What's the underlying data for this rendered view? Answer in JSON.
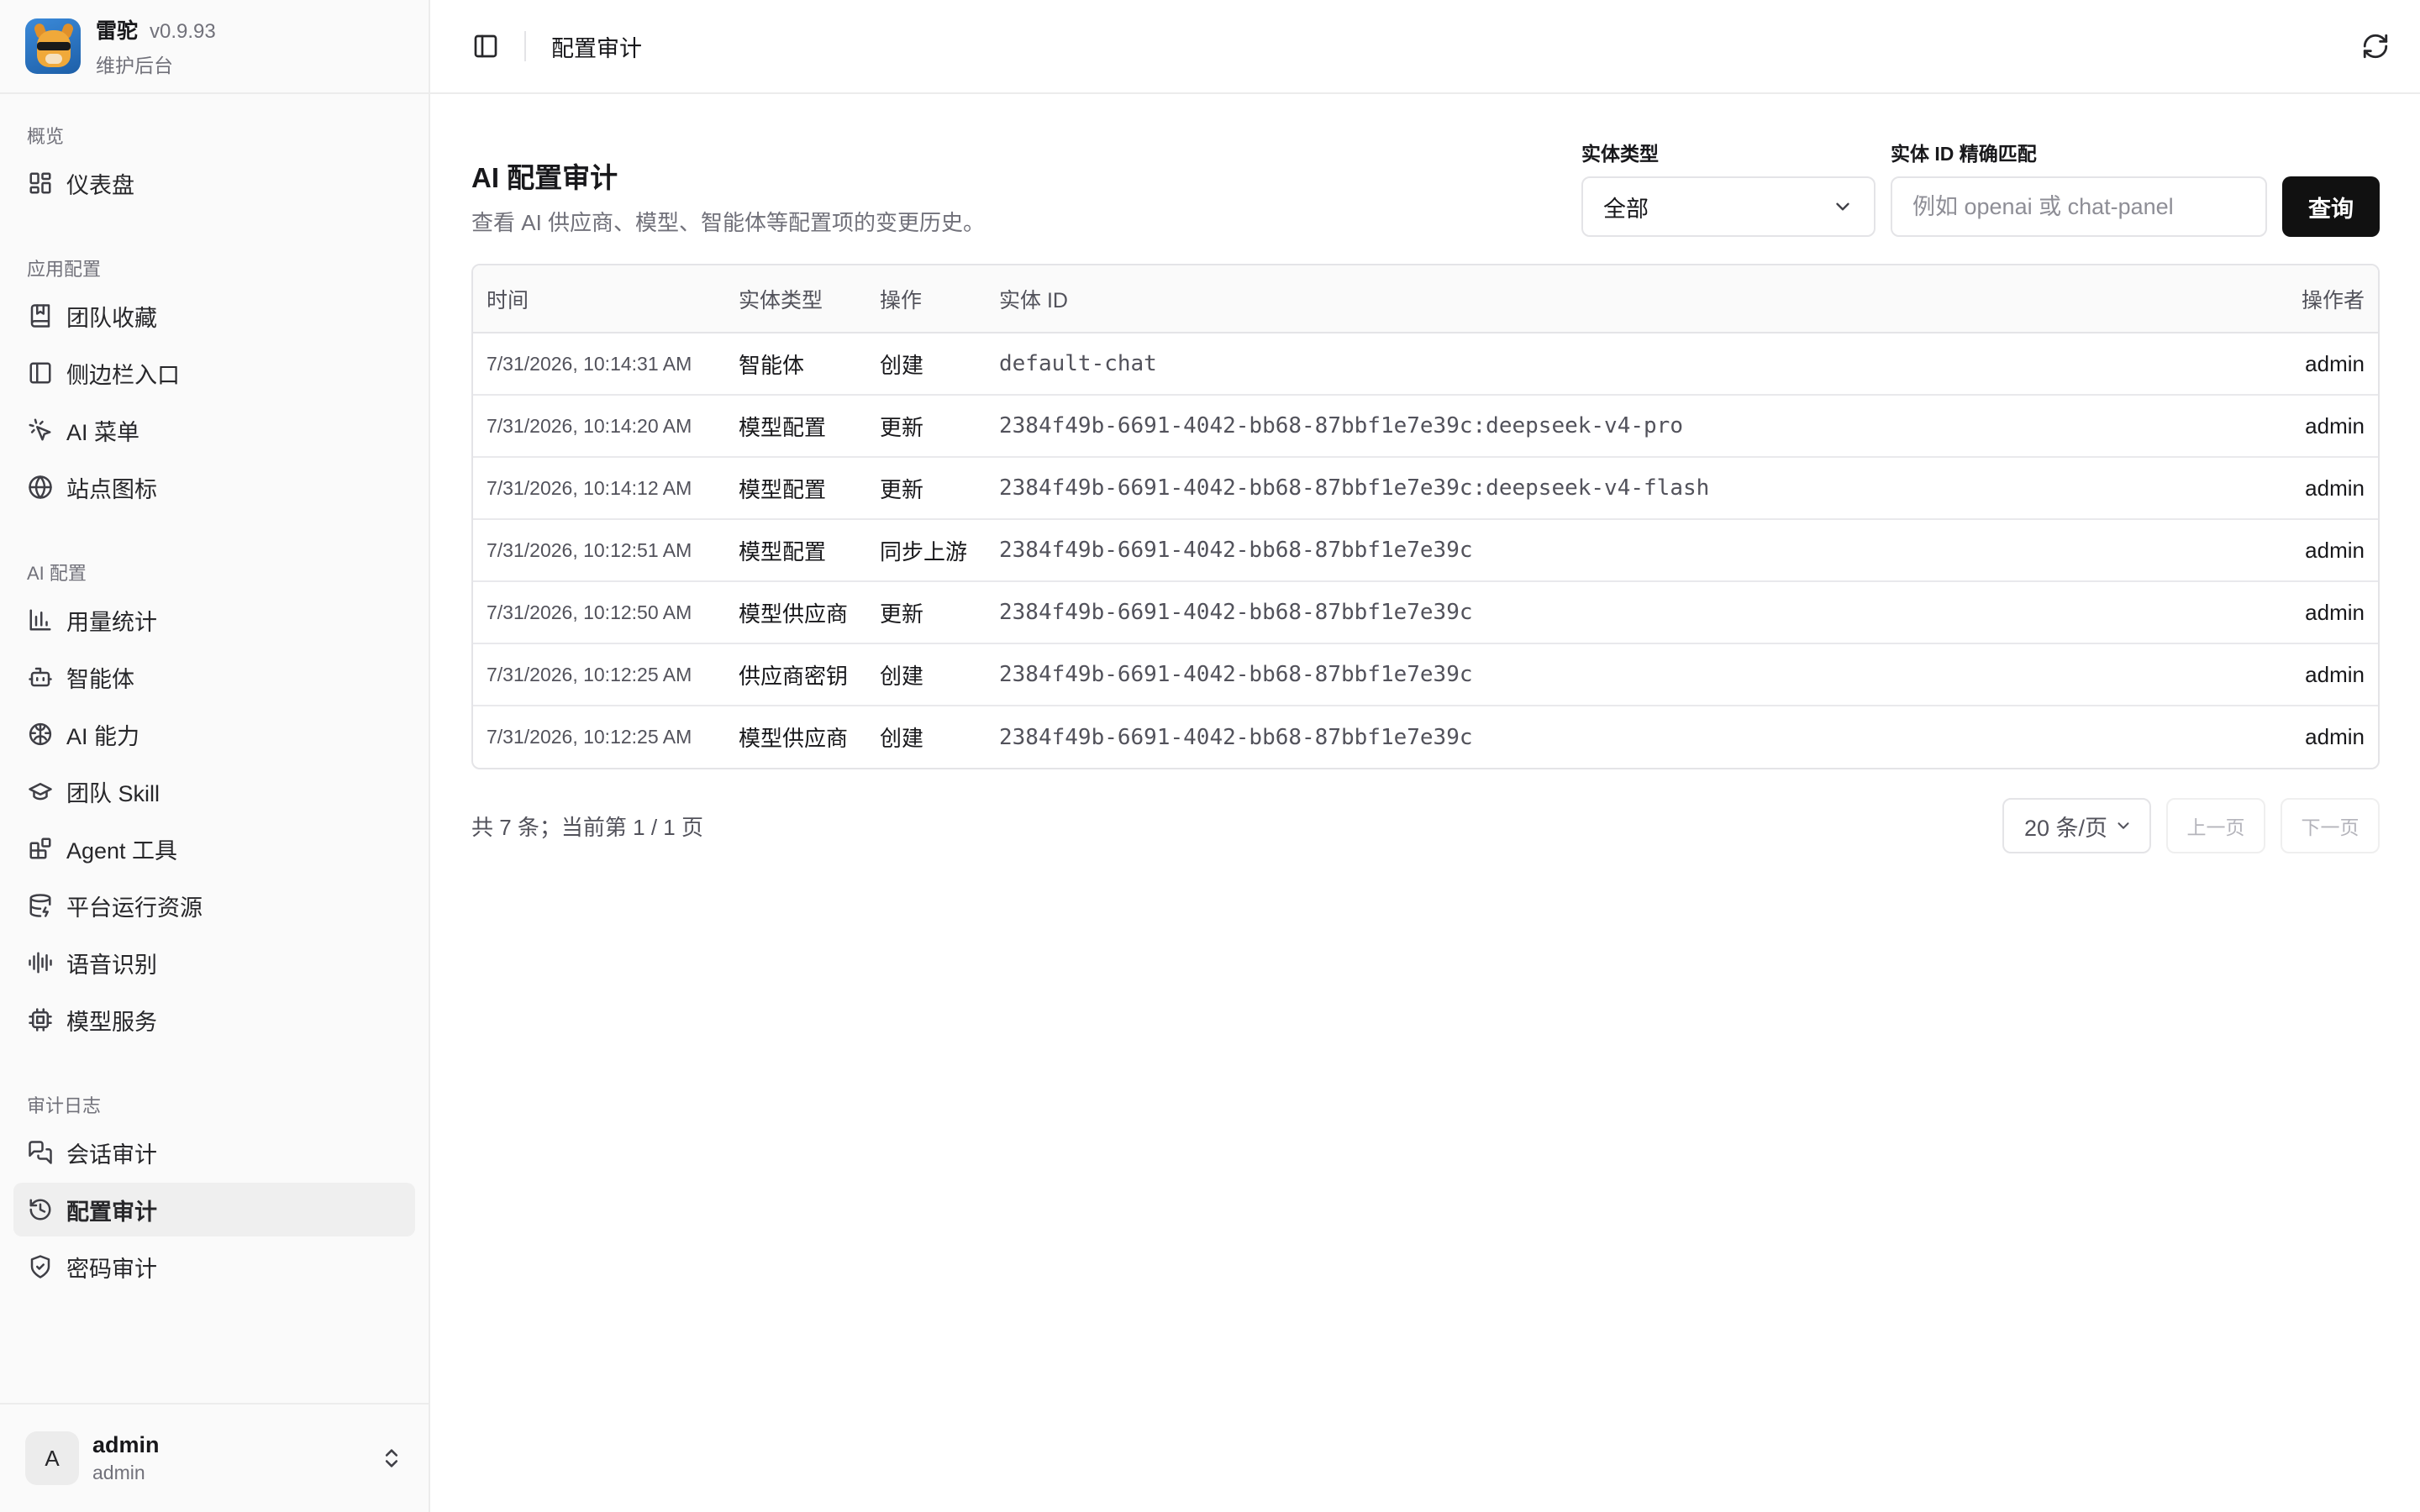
{
  "brand": {
    "name": "雷驼",
    "version": "v0.9.93",
    "subtitle": "维护后台"
  },
  "sidebar": {
    "groups": [
      {
        "title": "概览",
        "items": [
          {
            "label": "仪表盘",
            "icon": "dashboard-icon"
          }
        ]
      },
      {
        "title": "应用配置",
        "items": [
          {
            "label": "团队收藏",
            "icon": "bookmark-icon"
          },
          {
            "label": "侧边栏入口",
            "icon": "panel-icon"
          },
          {
            "label": "AI 菜单",
            "icon": "pointer-icon"
          },
          {
            "label": "站点图标",
            "icon": "globe-icon"
          }
        ]
      },
      {
        "title": "AI 配置",
        "items": [
          {
            "label": "用量统计",
            "icon": "bar-chart-icon"
          },
          {
            "label": "智能体",
            "icon": "bot-icon"
          },
          {
            "label": "AI 能力",
            "icon": "brain-icon"
          },
          {
            "label": "团队 Skill",
            "icon": "graduation-cap-icon"
          },
          {
            "label": "Agent 工具",
            "icon": "blocks-icon"
          },
          {
            "label": "平台运行资源",
            "icon": "database-icon"
          },
          {
            "label": "语音识别",
            "icon": "audio-wave-icon"
          },
          {
            "label": "模型服务",
            "icon": "cpu-icon"
          }
        ]
      },
      {
        "title": "审计日志",
        "items": [
          {
            "label": "会话审计",
            "icon": "messages-icon"
          },
          {
            "label": "配置审计",
            "icon": "history-icon",
            "active": true
          },
          {
            "label": "密码审计",
            "icon": "shield-icon"
          }
        ]
      }
    ]
  },
  "user": {
    "initial": "A",
    "name": "admin",
    "role": "admin"
  },
  "topbar": {
    "breadcrumb": "配置审计"
  },
  "page": {
    "title": "AI 配置审计",
    "description": "查看 AI 供应商、模型、智能体等配置项的变更历史。"
  },
  "filters": {
    "entity_type_label": "实体类型",
    "entity_type_value": "全部",
    "entity_id_label": "实体 ID 精确匹配",
    "entity_id_value": "",
    "entity_id_placeholder": "例如 openai 或 chat-panel",
    "query_label": "查询"
  },
  "table": {
    "headers": {
      "time": "时间",
      "entity_type": "实体类型",
      "action": "操作",
      "entity_id": "实体 ID",
      "operator": "操作者"
    },
    "rows": [
      {
        "time": "7/31/2026, 10:14:31 AM",
        "entity_type": "智能体",
        "action": "创建",
        "entity_id": "default-chat",
        "operator": "admin"
      },
      {
        "time": "7/31/2026, 10:14:20 AM",
        "entity_type": "模型配置",
        "action": "更新",
        "entity_id": "2384f49b-6691-4042-bb68-87bbf1e7e39c:deepseek-v4-pro",
        "operator": "admin"
      },
      {
        "time": "7/31/2026, 10:14:12 AM",
        "entity_type": "模型配置",
        "action": "更新",
        "entity_id": "2384f49b-6691-4042-bb68-87bbf1e7e39c:deepseek-v4-flash",
        "operator": "admin"
      },
      {
        "time": "7/31/2026, 10:12:51 AM",
        "entity_type": "模型配置",
        "action": "同步上游",
        "entity_id": "2384f49b-6691-4042-bb68-87bbf1e7e39c",
        "operator": "admin"
      },
      {
        "time": "7/31/2026, 10:12:50 AM",
        "entity_type": "模型供应商",
        "action": "更新",
        "entity_id": "2384f49b-6691-4042-bb68-87bbf1e7e39c",
        "operator": "admin"
      },
      {
        "time": "7/31/2026, 10:12:25 AM",
        "entity_type": "供应商密钥",
        "action": "创建",
        "entity_id": "2384f49b-6691-4042-bb68-87bbf1e7e39c",
        "operator": "admin"
      },
      {
        "time": "7/31/2026, 10:12:25 AM",
        "entity_type": "模型供应商",
        "action": "创建",
        "entity_id": "2384f49b-6691-4042-bb68-87bbf1e7e39c",
        "operator": "admin"
      }
    ]
  },
  "pagination": {
    "summary": "共 7 条；当前第 1 / 1 页",
    "page_size": "20 条/页",
    "prev": "上一页",
    "next": "下一页"
  }
}
